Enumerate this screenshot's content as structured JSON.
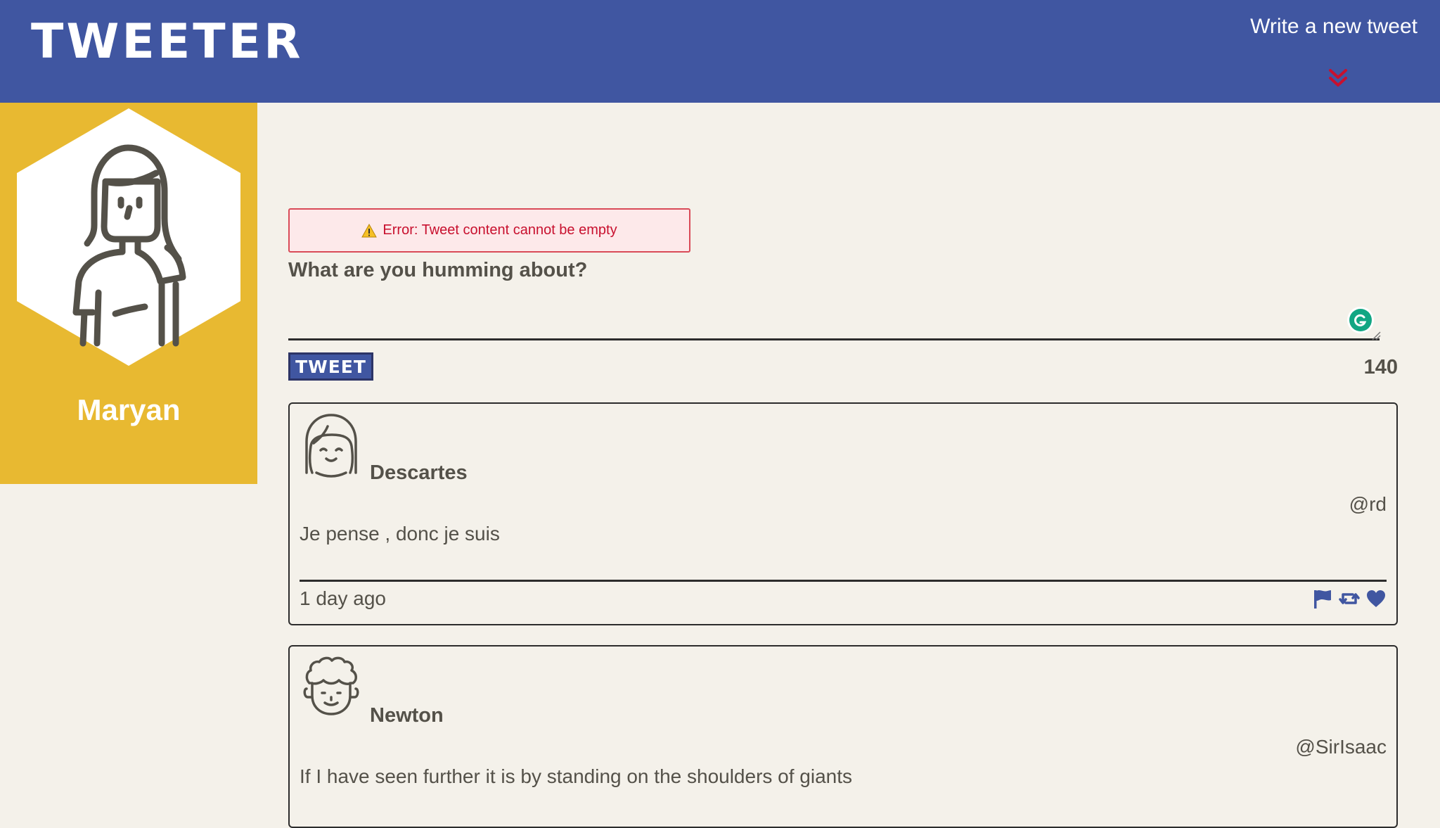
{
  "nav": {
    "brand": "TWEETER",
    "compose_label": "Write a new tweet",
    "compose_icon": "double-chevron-down-icon",
    "background": "#4056a1",
    "arrow_color": "#c8102e"
  },
  "profile": {
    "name": "Maryan",
    "avatar_icon": "woman-avatar-icon",
    "background": "#e8b931"
  },
  "composer": {
    "error": "Error: Tweet content cannot be empty",
    "error_icon": "warning-icon",
    "prompt": "What are you humming about?",
    "textarea_value": "",
    "button_label": "TWEET",
    "counter": "140"
  },
  "tweets": [
    {
      "name": "Descartes",
      "handle": "@rd",
      "content": "Je pense , donc je suis",
      "timestamp": "1 day ago",
      "avatar_icon": "smiling-girl-avatar-icon",
      "action_icons": [
        "flag-icon",
        "retweet-icon",
        "heart-icon"
      ]
    },
    {
      "name": "Newton",
      "handle": "@SirIsaac",
      "content": "If I have seen further it is by standing on the shoulders of giants",
      "avatar_icon": "curly-hair-man-avatar-icon"
    }
  ]
}
